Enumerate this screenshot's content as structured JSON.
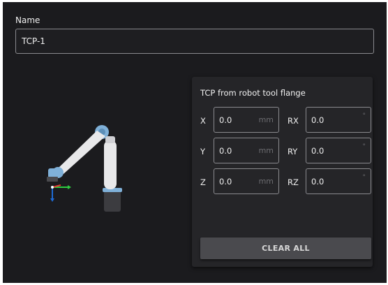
{
  "name": {
    "label": "Name",
    "value": "TCP-1"
  },
  "tcp": {
    "title": "TCP from robot tool flange",
    "position": [
      {
        "axis": "X",
        "value": "0.0",
        "unit": "mm"
      },
      {
        "axis": "Y",
        "value": "0.0",
        "unit": "mm"
      },
      {
        "axis": "Z",
        "value": "0.0",
        "unit": "mm"
      }
    ],
    "rotation": [
      {
        "axis": "RX",
        "value": "0.0",
        "unit": "°"
      },
      {
        "axis": "RY",
        "value": "0.0",
        "unit": "°"
      },
      {
        "axis": "RZ",
        "value": "0.0",
        "unit": "°"
      }
    ],
    "clear_label": "CLEAR ALL"
  },
  "colors": {
    "background": "#1b1b1e",
    "card": "#252528",
    "field_border": "#8a8a8e",
    "robot_joint": "#7fb0d8",
    "axis_x": "#e53935",
    "axis_y": "#2ecc40",
    "axis_z": "#1e6bd6"
  }
}
